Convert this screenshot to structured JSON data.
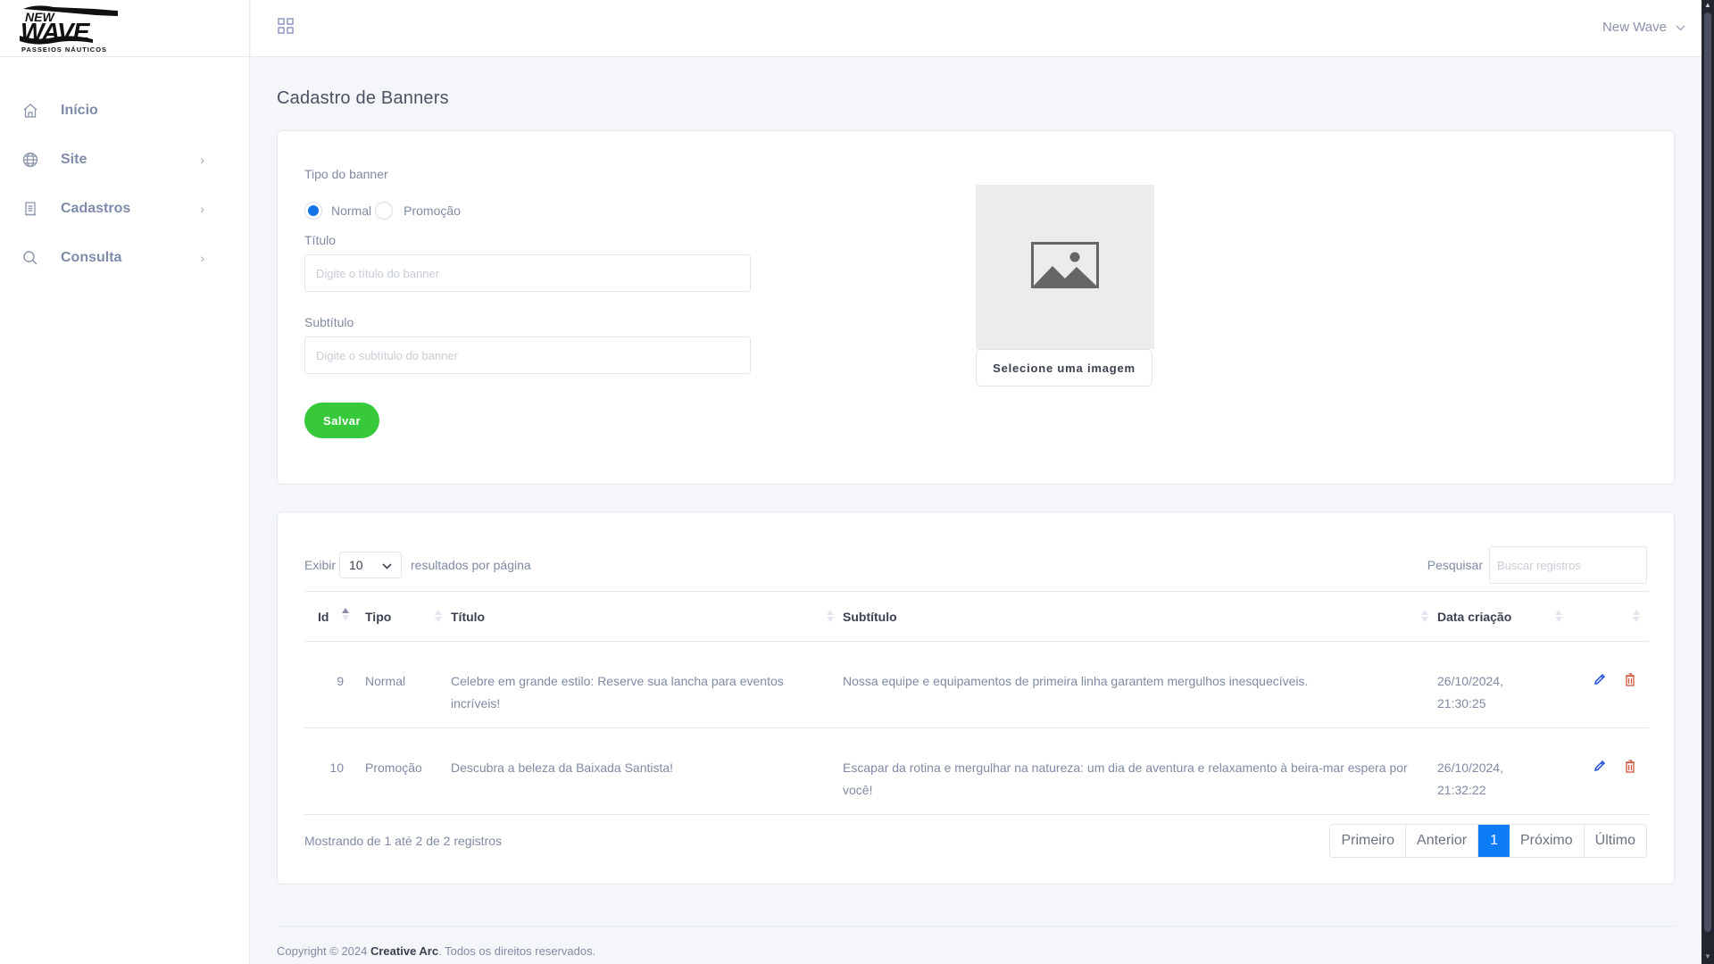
{
  "brand": {
    "logo_alt": "New Wave Passeios Náuticos",
    "logo_main": "NEW WAVE",
    "logo_sub": "PASSEIOS NÁUTICOS"
  },
  "sidebar": {
    "items": [
      {
        "label": "Início",
        "icon": "home-icon",
        "has_submenu": false
      },
      {
        "label": "Site",
        "icon": "globe-icon",
        "has_submenu": true
      },
      {
        "label": "Cadastros",
        "icon": "document-icon",
        "has_submenu": true
      },
      {
        "label": "Consulta",
        "icon": "search-icon",
        "has_submenu": true
      }
    ],
    "chevron": "›"
  },
  "topbar": {
    "apps_icon": "grid-icon",
    "user_name": "New Wave",
    "user_chevron": "⌄"
  },
  "page": {
    "title": "Cadastro de Banners"
  },
  "form": {
    "type_label": "Tipo do banner",
    "type_options": [
      {
        "label": "Normal",
        "checked": true
      },
      {
        "label": "Promoção",
        "checked": false
      }
    ],
    "title_label": "Título",
    "title_value": "",
    "title_placeholder": "Digite o título do banner",
    "subtitle_label": "Subtítulo",
    "subtitle_value": "",
    "subtitle_placeholder": "Digite o subtítulo do banner",
    "save_label": "Salvar",
    "image_placeholder_icon": "image-icon",
    "select_image_label": "Selecione uma imagem"
  },
  "table": {
    "length_label_before": "Exibir",
    "length_value": "10",
    "length_label_after": "resultados por página",
    "search_label": "Pesquisar",
    "search_placeholder": "Buscar registros",
    "search_value": "",
    "columns": [
      {
        "label": "Id",
        "sort": "asc"
      },
      {
        "label": "Tipo",
        "sort": "none"
      },
      {
        "label": "Título",
        "sort": "none"
      },
      {
        "label": "Subtítulo",
        "sort": "none"
      },
      {
        "label": "Data criação",
        "sort": "none"
      },
      {
        "label": "",
        "sort": "none"
      }
    ],
    "rows": [
      {
        "id": "9",
        "tipo": "Normal",
        "titulo": "Celebre em grande estilo: Reserve sua lancha para eventos incríveis!",
        "subtitulo": "Nossa equipe e equipamentos de primeira linha garantem mergulhos inesquecíveis.",
        "data_line1": "26/10/2024,",
        "data_line2": "21:30:25"
      },
      {
        "id": "10",
        "tipo": "Promoção",
        "titulo": "Descubra a beleza da Baixada Santista!",
        "subtitulo": "Escapar da rotina e mergulhar na natureza: um dia de aventura e relaxamento à beira-mar espera por você!",
        "data_line1": "26/10/2024,",
        "data_line2": "21:32:22"
      }
    ],
    "info": "Mostrando de 1 até 2 de 2 registros",
    "pagination": {
      "first": "Primeiro",
      "previous": "Anterior",
      "current": "1",
      "next": "Próximo",
      "last": "Último"
    }
  },
  "footer": {
    "prefix": "Copyright © 2024 ",
    "company": "Creative Arc",
    "suffix": ". Todos os direitos reservados."
  },
  "colors": {
    "accent_blue": "#0d7cf9",
    "save_green": "#37c93a",
    "edit_icon": "#1f4fe0",
    "delete_icon": "#d0553b"
  }
}
